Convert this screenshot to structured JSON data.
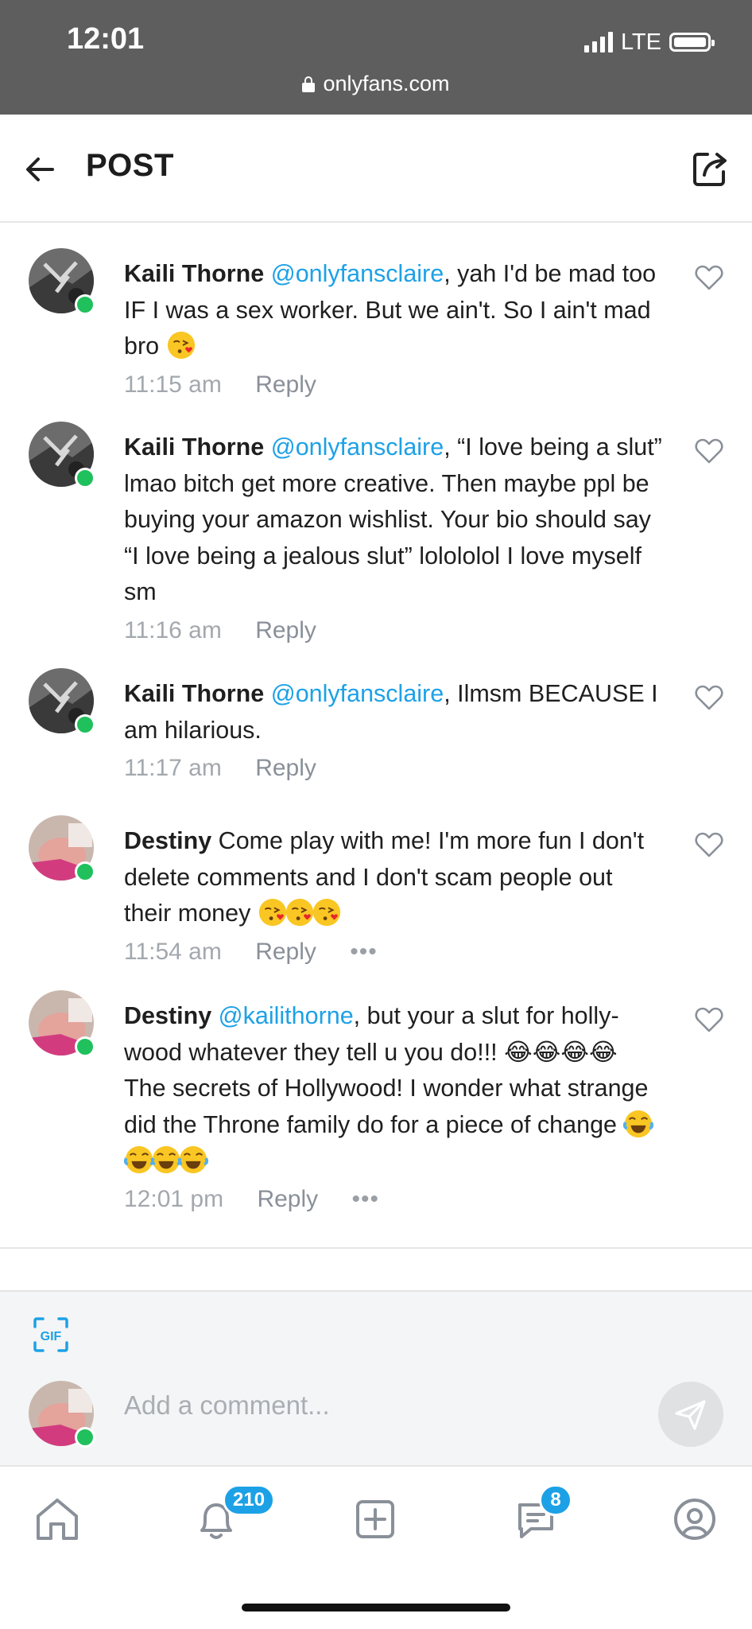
{
  "status_bar": {
    "time": "12:01",
    "network": "LTE",
    "url": "onlyfans.com"
  },
  "header": {
    "title": "POST"
  },
  "comments": [
    {
      "author": "Kaili Thorne",
      "mention": "@onlyfansclaire",
      "text": ", yah I'd be mad too IF I was a sex worker. But we ain't. So I ain't mad bro",
      "emojis": [
        "kissing-heart"
      ],
      "time": "11:15 am",
      "reply_label": "Reply",
      "has_more": false
    },
    {
      "author": "Kaili Thorne",
      "mention": "@onlyfansclaire",
      "text": ", “I love being a slut” lmao bitch get more creative. Then maybe ppl be buying your amazon wishlist. Your bio should say “I love being a jealous slut” lolololol I love myself sm",
      "emojis": [],
      "time": "11:16 am",
      "reply_label": "Reply",
      "has_more": false
    },
    {
      "author": "Kaili Thorne",
      "mention": "@onlyfansclaire",
      "text": ", Ilmsm BECAUSE I am hilarious.",
      "emojis": [],
      "time": "11:17 am",
      "reply_label": "Reply",
      "has_more": false
    },
    {
      "author": "Destiny",
      "mention": "",
      "text": " Come play with me! I'm more fun I don't delete comments and I don't scam people out their money",
      "emojis": [
        "kissing-heart",
        "kissing-heart",
        "kissing-heart"
      ],
      "time": "11:54 am",
      "reply_label": "Reply",
      "has_more": true
    },
    {
      "author": "Destiny",
      "mention": "@kailithorne",
      "text": ", but your a slut for holly-wood whatever they tell u you do!!! 😂😂😂😂 The secrets of Hollywood! I wonder what strange did the Throne family do for a piece of change",
      "emojis": [
        "joy",
        "joy",
        "joy",
        "joy"
      ],
      "time": "12:01 pm",
      "reply_label": "Reply",
      "has_more": true
    }
  ],
  "composer": {
    "placeholder": "Add a comment...",
    "gif_label": "GIF"
  },
  "tabbar": {
    "notifications_count": "210",
    "messages_count": "8",
    "items": [
      "home-icon",
      "bell-icon",
      "add-post-icon",
      "messages-icon",
      "profile-icon"
    ]
  },
  "colors": {
    "accent": "#1da1e6",
    "online": "#20c05c",
    "status_bar": "#5e5e5e"
  }
}
